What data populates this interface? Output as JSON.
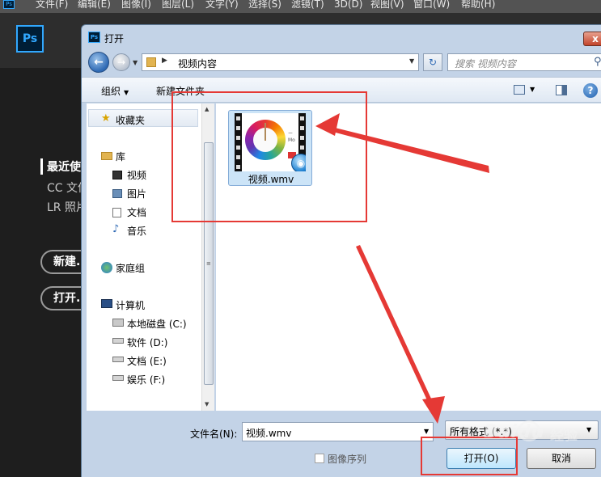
{
  "photoshop": {
    "app_icon": "Ps",
    "menu": [
      "文件(F)",
      "编辑(E)",
      "图像(I)",
      "图层(L)",
      "文字(Y)",
      "选择(S)",
      "滤镜(T)",
      "3D(D)",
      "视图(V)",
      "窗口(W)",
      "帮助(H)"
    ],
    "logo": "Ps",
    "sidebar": {
      "recent": "最近使",
      "cc_files": "CC 文件",
      "lr_photos": "LR 照片",
      "new_button": "新建...",
      "open_button": "打开..."
    }
  },
  "dialog": {
    "title": "打开",
    "title_icon": "Ps",
    "close_glyph": "x",
    "address": {
      "path": "视频内容"
    },
    "search": {
      "placeholder": "搜索 视频内容"
    },
    "toolbar": {
      "organize": "组织",
      "new_folder": "新建文件夹"
    },
    "nav": {
      "favorites": "收藏夹",
      "library": "库",
      "library_items": [
        "视频",
        "图片",
        "文档",
        "音乐"
      ],
      "homegroup": "家庭组",
      "computer": "计算机",
      "drives": [
        "本地磁盘 (C:)",
        "软件 (D:)",
        "文档 (E:)",
        "娱乐 (F:)"
      ]
    },
    "files": [
      {
        "name": "视频.wmv",
        "icon": "video-file-icon"
      }
    ],
    "filename_label": "文件名(N):",
    "filename_value": "视频.wmv",
    "filetype_value": "所有格式 (*.*)",
    "image_sequence_label": "图像序列",
    "open_button": "打开(O)",
    "cancel_button": "取消"
  },
  "annotation_color": "#e53935",
  "watermark": {
    "brand": "Baidu",
    "sub": "经验"
  }
}
